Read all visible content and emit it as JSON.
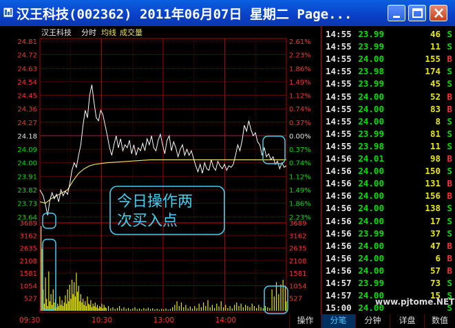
{
  "window": {
    "title": "汉王科技(002362) 2011年06月07日 星期二 Page..."
  },
  "chart_header": {
    "stock_name": "汉王科技",
    "mode": "分时",
    "avg_line": "均线",
    "volume": "成交量"
  },
  "annotation": {
    "line1": "今日操作两",
    "line2": "次买入点"
  },
  "colors": {
    "up": "#ff3030",
    "down": "#00e000",
    "flat": "#e6e6e6",
    "grid": "#b00000",
    "price_line": "#ffffff",
    "avg_line": "#e8e060",
    "volume": "#e8e800",
    "annotation": "#40d0f0"
  },
  "chart_data": {
    "type": "line",
    "prev_close": 24.18,
    "y_ticks": [
      {
        "price": "24.81",
        "pct": "2.61%",
        "dir": "up"
      },
      {
        "price": "24.72",
        "pct": "2.23%",
        "dir": "up"
      },
      {
        "price": "24.63",
        "pct": "1.86%",
        "dir": "up"
      },
      {
        "price": "24.54",
        "pct": "1.49%",
        "dir": "up"
      },
      {
        "price": "24.45",
        "pct": "1.12%",
        "dir": "up"
      },
      {
        "price": "24.36",
        "pct": "0.74%",
        "dir": "up"
      },
      {
        "price": "24.27",
        "pct": "0.37%",
        "dir": "up"
      },
      {
        "price": "24.18",
        "pct": "0.00%",
        "dir": "flat"
      },
      {
        "price": "24.09",
        "pct": "0.37%",
        "dir": "down"
      },
      {
        "price": "24.00",
        "pct": "0.74%",
        "dir": "down"
      },
      {
        "price": "23.91",
        "pct": "1.12%",
        "dir": "down"
      },
      {
        "price": "23.82",
        "pct": "1.49%",
        "dir": "down"
      },
      {
        "price": "23.73",
        "pct": "1.86%",
        "dir": "down"
      },
      {
        "price": "23.64",
        "pct": "2.23%",
        "dir": "down"
      }
    ],
    "ylim": [
      23.6,
      24.81
    ],
    "volume_ticks": [
      "3689",
      "3162",
      "2635",
      "2108",
      "1581",
      "1054",
      "527"
    ],
    "volume_max": 3689,
    "x_ticks": [
      "09:30",
      "10:30",
      "13:00",
      "14:00"
    ],
    "price_series": [
      [
        0,
        23.82
      ],
      [
        3,
        23.78
      ],
      [
        5,
        23.72
      ],
      [
        7,
        23.65
      ],
      [
        9,
        23.75
      ],
      [
        11,
        23.8
      ],
      [
        13,
        23.76
      ],
      [
        15,
        23.79
      ],
      [
        17,
        23.74
      ],
      [
        19,
        23.82
      ],
      [
        21,
        23.78
      ],
      [
        23,
        23.81
      ],
      [
        25,
        23.79
      ],
      [
        27,
        23.86
      ],
      [
        29,
        23.95
      ],
      [
        31,
        24.0
      ],
      [
        33,
        23.97
      ],
      [
        35,
        24.05
      ],
      [
        37,
        24.12
      ],
      [
        39,
        24.25
      ],
      [
        41,
        24.35
      ],
      [
        43,
        24.3
      ],
      [
        45,
        24.45
      ],
      [
        47,
        24.52
      ],
      [
        49,
        24.4
      ],
      [
        51,
        24.3
      ],
      [
        53,
        24.28
      ],
      [
        55,
        24.35
      ],
      [
        57,
        24.32
      ],
      [
        59,
        24.25
      ],
      [
        61,
        24.18
      ],
      [
        63,
        24.1
      ],
      [
        65,
        24.05
      ],
      [
        67,
        24.12
      ],
      [
        69,
        24.18
      ],
      [
        71,
        24.1
      ],
      [
        73,
        24.16
      ],
      [
        75,
        24.08
      ],
      [
        77,
        24.12
      ],
      [
        79,
        24.1
      ],
      [
        81,
        24.15
      ],
      [
        83,
        24.06
      ],
      [
        85,
        24.12
      ],
      [
        87,
        24.05
      ],
      [
        89,
        24.1
      ],
      [
        91,
        24.08
      ],
      [
        93,
        24.13
      ],
      [
        95,
        24.08
      ],
      [
        97,
        24.16
      ],
      [
        99,
        24.12
      ],
      [
        101,
        24.18
      ],
      [
        103,
        24.1
      ],
      [
        105,
        24.08
      ],
      [
        107,
        24.15
      ],
      [
        109,
        24.19
      ],
      [
        111,
        24.12
      ],
      [
        113,
        24.06
      ],
      [
        115,
        24.15
      ],
      [
        117,
        24.18
      ],
      [
        119,
        24.08
      ],
      [
        121,
        24.14
      ],
      [
        123,
        24.1
      ],
      [
        125,
        24.04
      ],
      [
        127,
        24.09
      ],
      [
        129,
        24.12
      ],
      [
        131,
        24.05
      ],
      [
        133,
        24.09
      ],
      [
        135,
        24.05
      ],
      [
        137,
        24.08
      ],
      [
        139,
        24.03
      ],
      [
        141,
        23.98
      ],
      [
        143,
        23.94
      ],
      [
        145,
        23.99
      ],
      [
        147,
        23.93
      ],
      [
        149,
        24.0
      ],
      [
        151,
        23.96
      ],
      [
        153,
        23.95
      ],
      [
        155,
        24.02
      ],
      [
        157,
        23.97
      ],
      [
        159,
        23.95
      ],
      [
        161,
        24.01
      ],
      [
        163,
        23.98
      ],
      [
        165,
        23.96
      ],
      [
        167,
        23.99
      ],
      [
        169,
        23.95
      ],
      [
        171,
        23.98
      ],
      [
        173,
        23.97
      ],
      [
        175,
        23.99
      ],
      [
        177,
        24.05
      ],
      [
        179,
        24.12
      ],
      [
        181,
        24.08
      ],
      [
        183,
        24.15
      ],
      [
        185,
        24.25
      ],
      [
        187,
        24.21
      ],
      [
        189,
        24.28
      ],
      [
        191,
        24.22
      ],
      [
        193,
        24.18
      ],
      [
        195,
        24.2
      ],
      [
        197,
        24.14
      ],
      [
        199,
        24.12
      ],
      [
        201,
        24.05
      ],
      [
        203,
        24.1
      ],
      [
        205,
        24.04
      ],
      [
        207,
        24.06
      ],
      [
        209,
        24.02
      ],
      [
        211,
        24.04
      ],
      [
        213,
        23.99
      ],
      [
        215,
        24.01
      ],
      [
        217,
        23.96
      ],
      [
        219,
        24.0
      ],
      [
        221,
        23.97
      ],
      [
        223,
        23.98
      ]
    ],
    "avg_series": [
      [
        0,
        23.74
      ],
      [
        5,
        23.73
      ],
      [
        10,
        23.76
      ],
      [
        15,
        23.78
      ],
      [
        20,
        23.8
      ],
      [
        25,
        23.82
      ],
      [
        30,
        23.88
      ],
      [
        35,
        23.93
      ],
      [
        40,
        23.96
      ],
      [
        45,
        23.98
      ],
      [
        50,
        23.99
      ],
      [
        60,
        24.0
      ],
      [
        80,
        24.01
      ],
      [
        100,
        24.02
      ],
      [
        120,
        24.02
      ],
      [
        140,
        24.02
      ],
      [
        160,
        24.02
      ],
      [
        180,
        24.02
      ],
      [
        200,
        24.02
      ],
      [
        223,
        24.02
      ]
    ],
    "volume_bars": [
      [
        1,
        3550
      ],
      [
        2,
        2600
      ],
      [
        3,
        900
      ],
      [
        4,
        300
      ],
      [
        5,
        1400
      ],
      [
        6,
        500
      ],
      [
        7,
        200
      ],
      [
        8,
        1650
      ],
      [
        9,
        400
      ],
      [
        10,
        700
      ],
      [
        11,
        250
      ],
      [
        12,
        900
      ],
      [
        13,
        350
      ],
      [
        14,
        500
      ],
      [
        15,
        150
      ],
      [
        16,
        300
      ],
      [
        17,
        200
      ],
      [
        18,
        600
      ],
      [
        19,
        250
      ],
      [
        20,
        450
      ],
      [
        21,
        200
      ],
      [
        22,
        350
      ],
      [
        23,
        650
      ],
      [
        24,
        300
      ],
      [
        25,
        900
      ],
      [
        26,
        400
      ],
      [
        27,
        1100
      ],
      [
        28,
        500
      ],
      [
        29,
        1300
      ],
      [
        30,
        700
      ],
      [
        31,
        1200
      ],
      [
        32,
        600
      ],
      [
        33,
        1600
      ],
      [
        34,
        800
      ],
      [
        35,
        1050
      ],
      [
        36,
        400
      ],
      [
        37,
        700
      ],
      [
        38,
        350
      ],
      [
        39,
        500
      ],
      [
        40,
        250
      ],
      [
        41,
        400
      ],
      [
        42,
        200
      ],
      [
        43,
        600
      ],
      [
        44,
        300
      ],
      [
        45,
        250
      ],
      [
        46,
        450
      ],
      [
        47,
        150
      ],
      [
        48,
        300
      ],
      [
        49,
        200
      ],
      [
        50,
        350
      ],
      [
        51,
        150
      ],
      [
        52,
        250
      ],
      [
        53,
        100
      ],
      [
        54,
        200
      ],
      [
        55,
        150
      ],
      [
        56,
        300
      ],
      [
        57,
        100
      ],
      [
        58,
        250
      ],
      [
        59,
        150
      ],
      [
        60,
        120
      ],
      [
        62,
        200
      ],
      [
        64,
        100
      ],
      [
        66,
        150
      ],
      [
        68,
        80
      ],
      [
        70,
        120
      ],
      [
        72,
        200
      ],
      [
        74,
        90
      ],
      [
        76,
        150
      ],
      [
        78,
        80
      ],
      [
        80,
        120
      ],
      [
        82,
        60
      ],
      [
        84,
        100
      ],
      [
        86,
        150
      ],
      [
        88,
        70
      ],
      [
        90,
        100
      ],
      [
        92,
        60
      ],
      [
        94,
        120
      ],
      [
        96,
        80
      ],
      [
        98,
        130
      ],
      [
        100,
        70
      ],
      [
        102,
        110
      ],
      [
        104,
        60
      ],
      [
        106,
        90
      ],
      [
        108,
        50
      ],
      [
        110,
        80
      ],
      [
        112,
        60
      ],
      [
        114,
        100
      ],
      [
        116,
        50
      ],
      [
        118,
        80
      ],
      [
        120,
        150
      ],
      [
        122,
        250
      ],
      [
        124,
        400
      ],
      [
        126,
        200
      ],
      [
        128,
        350
      ],
      [
        130,
        150
      ],
      [
        132,
        250
      ],
      [
        134,
        100
      ],
      [
        136,
        180
      ],
      [
        138,
        90
      ],
      [
        140,
        200
      ],
      [
        142,
        120
      ],
      [
        144,
        300
      ],
      [
        146,
        150
      ],
      [
        148,
        350
      ],
      [
        150,
        200
      ],
      [
        152,
        450
      ],
      [
        154,
        150
      ],
      [
        156,
        250
      ],
      [
        158,
        120
      ],
      [
        160,
        300
      ],
      [
        162,
        180
      ],
      [
        164,
        400
      ],
      [
        166,
        150
      ],
      [
        168,
        250
      ],
      [
        170,
        120
      ],
      [
        172,
        200
      ],
      [
        174,
        100
      ],
      [
        176,
        250
      ],
      [
        178,
        350
      ],
      [
        180,
        200
      ],
      [
        182,
        300
      ],
      [
        184,
        150
      ],
      [
        186,
        250
      ],
      [
        188,
        200
      ],
      [
        190,
        150
      ],
      [
        192,
        300
      ],
      [
        194,
        200
      ],
      [
        196,
        120
      ],
      [
        198,
        250
      ],
      [
        200,
        150
      ],
      [
        202,
        100
      ],
      [
        204,
        200
      ],
      [
        206,
        150
      ],
      [
        208,
        120
      ],
      [
        210,
        900
      ],
      [
        212,
        600
      ],
      [
        214,
        1200
      ],
      [
        216,
        700
      ],
      [
        218,
        1100
      ],
      [
        220,
        1300
      ],
      [
        222,
        1050
      ],
      [
        223,
        400
      ]
    ]
  },
  "ticks": [
    {
      "time": "14:55",
      "price": "23.99",
      "vol": "46",
      "side": "S"
    },
    {
      "time": "14:55",
      "price": "23.99",
      "vol": "11",
      "side": "S"
    },
    {
      "time": "14:55",
      "price": "24.00",
      "vol": "155",
      "side": "B"
    },
    {
      "time": "14:55",
      "price": "23.98",
      "vol": "174",
      "side": "S"
    },
    {
      "time": "14:55",
      "price": "23.99",
      "vol": "45",
      "side": "S"
    },
    {
      "time": "14:55",
      "price": "24.00",
      "vol": "52",
      "side": "B"
    },
    {
      "time": "14:55",
      "price": "24.00",
      "vol": "83",
      "side": "B"
    },
    {
      "time": "14:55",
      "price": "24.00",
      "vol": "8",
      "side": "S"
    },
    {
      "time": "14:55",
      "price": "23.99",
      "vol": "81",
      "side": "S"
    },
    {
      "time": "14:55",
      "price": "23.98",
      "vol": "11",
      "side": "S"
    },
    {
      "time": "14:56",
      "price": "24.01",
      "vol": "98",
      "side": "B"
    },
    {
      "time": "14:56",
      "price": "24.00",
      "vol": "150",
      "side": "S"
    },
    {
      "time": "14:56",
      "price": "24.00",
      "vol": "131",
      "side": "B"
    },
    {
      "time": "14:56",
      "price": "24.00",
      "vol": "156",
      "side": "B"
    },
    {
      "time": "14:56",
      "price": "24.00",
      "vol": "138",
      "side": "S"
    },
    {
      "time": "14:56",
      "price": "24.00",
      "vol": "17",
      "side": "S"
    },
    {
      "time": "14:56",
      "price": "23.99",
      "vol": "37",
      "side": "S"
    },
    {
      "time": "14:56",
      "price": "24.00",
      "vol": "47",
      "side": "B"
    },
    {
      "time": "14:56",
      "price": "24.00",
      "vol": "6",
      "side": "B"
    },
    {
      "time": "14:56",
      "price": "24.00",
      "vol": "57",
      "side": "B"
    },
    {
      "time": "14:57",
      "price": "23.99",
      "vol": "73",
      "side": "S"
    },
    {
      "time": "14:57",
      "price": "24.00",
      "vol": "15",
      "side": "S"
    },
    {
      "time": "15:00",
      "price": "24.00",
      "vol": "",
      "side": "S"
    }
  ],
  "tabs": [
    {
      "label": "操作",
      "active": false
    },
    {
      "label": "分笔",
      "active": true
    },
    {
      "label": "分钟",
      "active": false
    },
    {
      "label": "详盘",
      "active": false
    },
    {
      "label": "数值",
      "active": false
    }
  ],
  "watermark": "www.pjtome.NET"
}
